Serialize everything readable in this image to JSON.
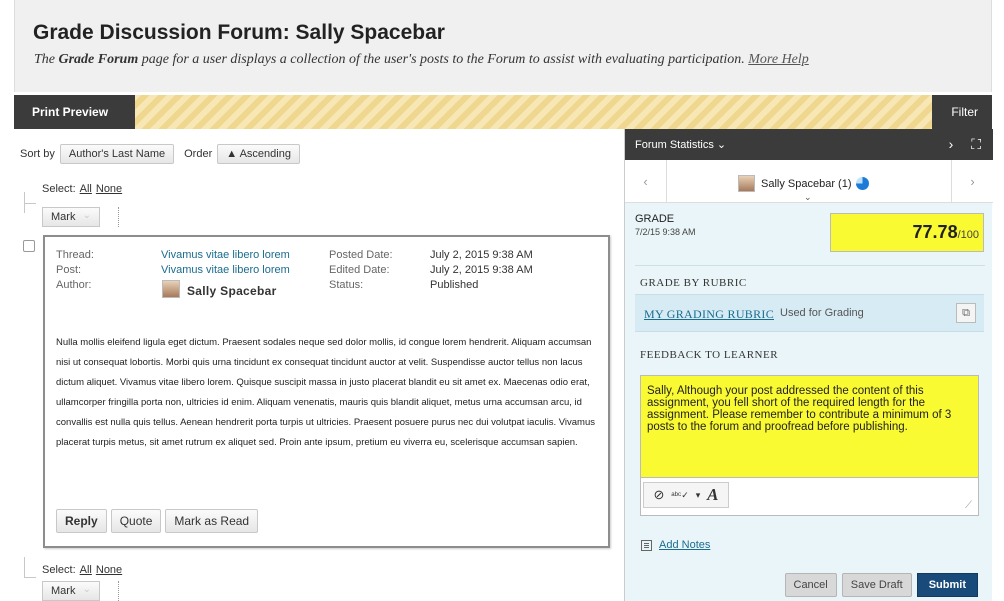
{
  "header": {
    "title": "Grade Discussion Forum: Sally Spacebar",
    "subtitle_pre": "The ",
    "subtitle_bold": "Grade Forum",
    "subtitle_post": " page for a user displays a collection of the user's posts to the Forum to assist with evaluating participation. ",
    "help_link": "More Help"
  },
  "toolbar": {
    "print_label": "Print Preview",
    "filter_label": "Filter"
  },
  "sort": {
    "sort_by_label": "Sort by",
    "sort_value": "Author's Last Name",
    "order_label": "Order",
    "order_value": "▲ Ascending"
  },
  "select": {
    "label": "Select:",
    "all": "All",
    "none": "None"
  },
  "mark": {
    "label": "Mark"
  },
  "post": {
    "thread_label": "Thread:",
    "thread_value": "Vivamus vitae libero lorem",
    "post_label": "Post:",
    "post_value": "Vivamus vitae libero lorem",
    "author_label": "Author:",
    "author_value": "Sally Spacebar",
    "posted_label": "Posted Date:",
    "posted_value": "July 2, 2015 9:38 AM",
    "edited_label": "Edited Date:",
    "edited_value": "July 2, 2015 9:38 AM",
    "status_label": "Status:",
    "status_value": "Published",
    "body": "Nulla mollis eleifend ligula eget dictum. Praesent sodales neque sed dolor mollis, id congue lorem hendrerit. Aliquam accumsan nisi ut consequat lobortis. Morbi quis urna tincidunt ex consequat tincidunt auctor at velit. Suspendisse auctor tellus non lacus dictum aliquet. Vivamus vitae libero lorem. Quisque suscipit massa in justo placerat blandit eu sit amet ex. Maecenas odio erat, ullamcorper fringilla porta non, ultricies id enim. Aliquam venenatis, mauris quis blandit aliquet, metus urna accumsan arcu, id convallis est nulla quis tellus. Aenean hendrerit porta turpis ut ultricies. Praesent posuere purus nec dui volutpat iaculis. Vivamus placerat turpis metus, sit amet rutrum ex aliquet sed. Proin ante ipsum, pretium eu viverra eu, scelerisque accumsan sapien.",
    "reply_label": "Reply",
    "quote_label": "Quote",
    "mark_read_label": "Mark as Read"
  },
  "stats": {
    "label": "Forum Statistics ⌄",
    "next_icon": "›",
    "expand_icon": "⛶"
  },
  "user_nav": {
    "prev": "‹",
    "next": "›",
    "user_label": "Sally Spacebar (1)",
    "chevron": "⌄"
  },
  "grade": {
    "label": "GRADE",
    "date": "7/2/15 9:38 AM",
    "score": "77.78",
    "max": "/100"
  },
  "rubric": {
    "section_title": "GRADE BY RUBRIC",
    "link": "MY GRADING RUBRIC",
    "used_label": "Used for Grading",
    "icon": "⧉"
  },
  "feedback": {
    "section_title": "FEEDBACK TO LEARNER",
    "text": "Sally, Although your post addressed the content of this assignment, you fell short of the required length for the assignment. Please remember to contribute a minimum of 3 posts to the forum and proofread before publishing."
  },
  "editor": {
    "attach_icon": "⊘",
    "spell_icon": "ᵃᵇᶜ✓",
    "dropdown_icon": "▾",
    "format_icon": "A",
    "resize_icon": "⟋"
  },
  "notes": {
    "label": "Add Notes"
  },
  "actions": {
    "cancel": "Cancel",
    "save_draft": "Save Draft",
    "submit": "Submit"
  }
}
